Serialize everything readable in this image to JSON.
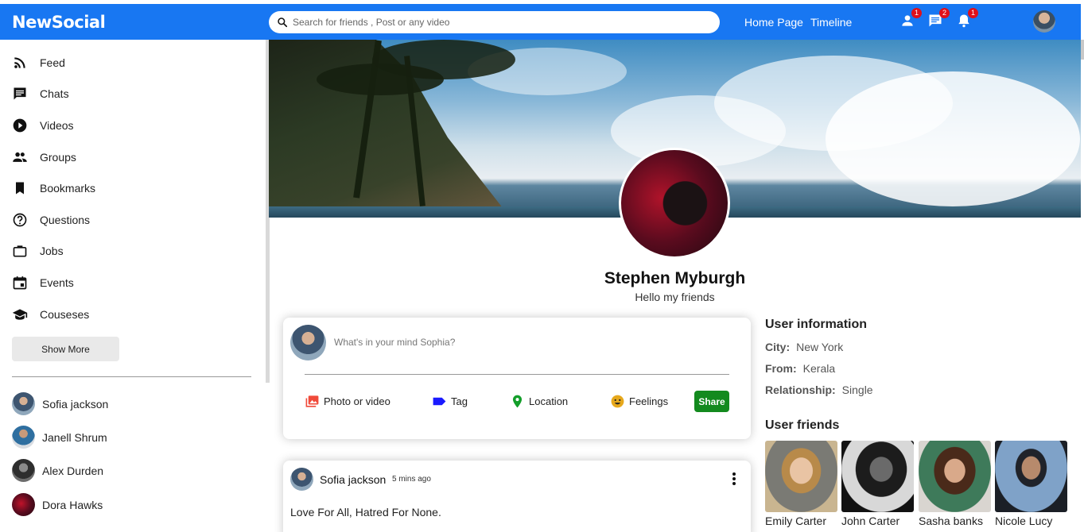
{
  "app": {
    "logo": "NewSocial"
  },
  "search": {
    "placeholder": "Search for friends , Post or any video"
  },
  "nav": {
    "links": [
      "Home Page",
      "Timeline"
    ]
  },
  "top_icons": [
    {
      "name": "person-icon",
      "badge": "1"
    },
    {
      "name": "chat-icon",
      "badge": "2"
    },
    {
      "name": "bell-icon",
      "badge": "1"
    }
  ],
  "sidebar": {
    "items": [
      {
        "label": "Feed",
        "icon": "rss-feed-icon"
      },
      {
        "label": "Chats",
        "icon": "chat-icon"
      },
      {
        "label": "Videos",
        "icon": "play-circle-icon"
      },
      {
        "label": "Groups",
        "icon": "group-icon"
      },
      {
        "label": "Bookmarks",
        "icon": "bookmark-icon"
      },
      {
        "label": "Questions",
        "icon": "help-circle-icon"
      },
      {
        "label": "Jobs",
        "icon": "briefcase-icon"
      },
      {
        "label": "Events",
        "icon": "calendar-icon"
      },
      {
        "label": "Couseses",
        "icon": "school-icon"
      }
    ],
    "show_more": "Show More",
    "friends": [
      "Sofia jackson",
      "Janell Shrum",
      "Alex Durden",
      "Dora Hawks"
    ]
  },
  "profile": {
    "name": "Stephen Myburgh",
    "bio": "Hello my friends"
  },
  "share": {
    "placeholder": "What's in your mind Sophia?",
    "options": [
      "Photo or video",
      "Tag",
      "Location",
      "Feelings"
    ],
    "button": "Share"
  },
  "post": {
    "user": "Sofia jackson",
    "time": "5 mins ago",
    "text": "Love For All, Hatred For None."
  },
  "user_info": {
    "title": "User information",
    "rows": [
      {
        "key": "City:",
        "value": "New York"
      },
      {
        "key": "From:",
        "value": "Kerala"
      },
      {
        "key": "Relationship:",
        "value": "Single"
      }
    ]
  },
  "user_friends": {
    "title": "User friends",
    "list": [
      "Emily Carter",
      "John Carter",
      "Sasha banks",
      "Nicole Lucy"
    ]
  },
  "colors": {
    "brand": "#1877f2",
    "badge": "#e0101a",
    "share_button": "#138a1e"
  }
}
